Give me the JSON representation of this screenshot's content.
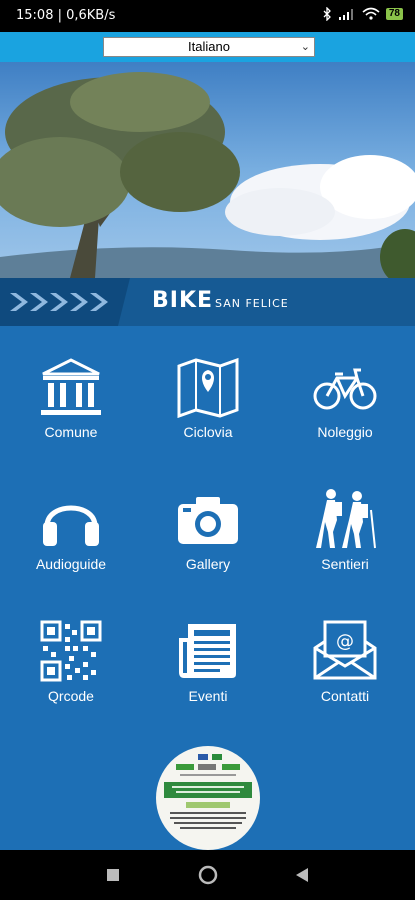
{
  "status": {
    "time": "15:08 | 0,6KB/s",
    "battery": "78"
  },
  "language": {
    "selected": "Italiano"
  },
  "banner": {
    "brand": "BIKE",
    "sub": "SAN FELICE"
  },
  "menu": [
    {
      "label": "Comune"
    },
    {
      "label": "Ciclovia"
    },
    {
      "label": "Noleggio"
    },
    {
      "label": "Audioguide"
    },
    {
      "label": "Gallery"
    },
    {
      "label": "Sentieri"
    },
    {
      "label": "Qrcode"
    },
    {
      "label": "Eventi"
    },
    {
      "label": "Contatti"
    }
  ]
}
